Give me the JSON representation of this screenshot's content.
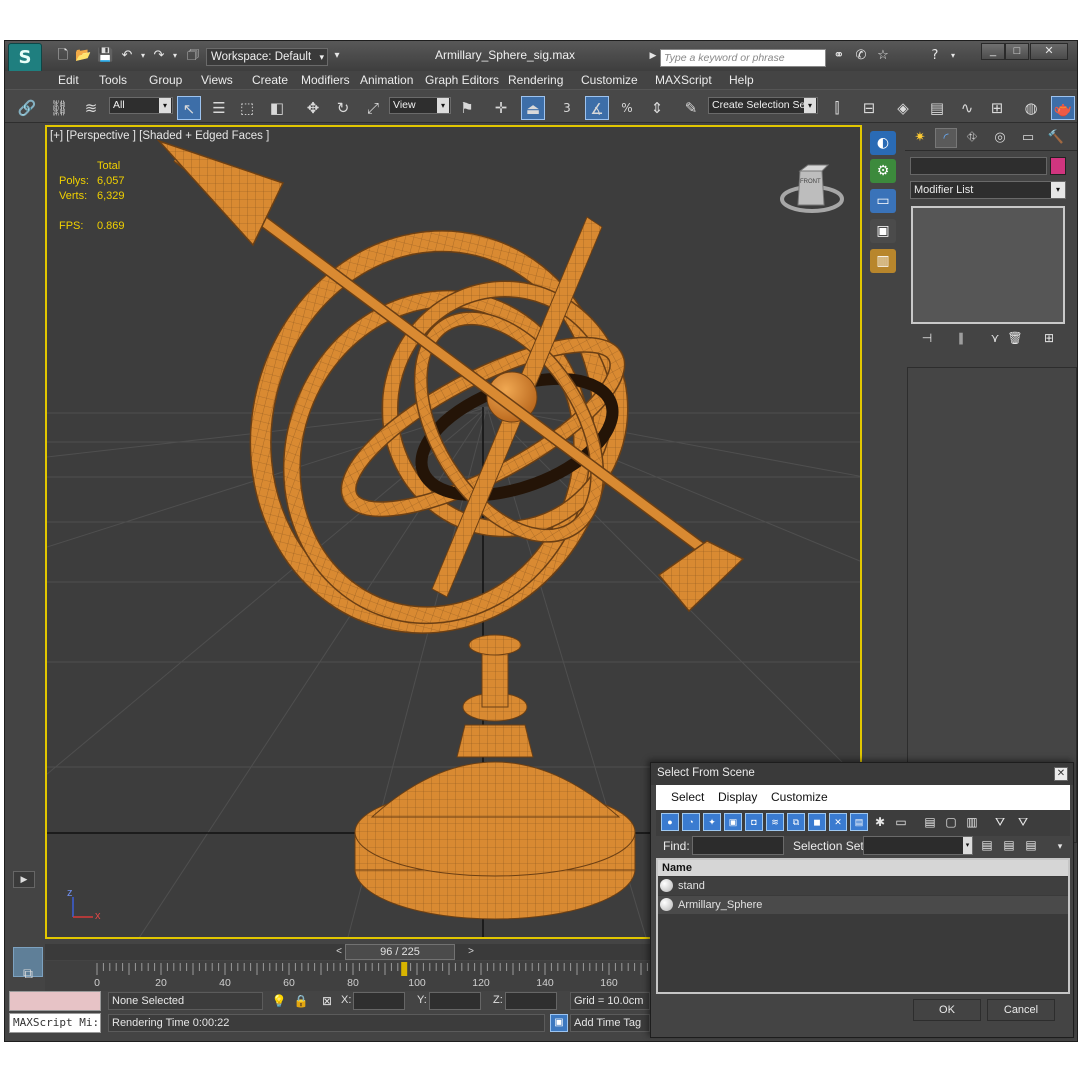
{
  "app": {
    "document_title": "Armillary_Sphere_sig.max",
    "workspace": "Workspace: Default",
    "search_placeholder": "Type a keyword or phrase",
    "window_buttons": [
      "_",
      "□",
      "✕"
    ]
  },
  "menu": [
    "Edit",
    "Tools",
    "Group",
    "Views",
    "Create",
    "Modifiers",
    "Animation",
    "Graph Editors",
    "Rendering",
    "Customize",
    "MAXScript",
    "Help"
  ],
  "toolbar": {
    "selection_filter": "All",
    "reference_coord": "View",
    "named_selection_placeholder": "Create Selection Se",
    "snap_label": "3",
    "angle_snap_label": "%"
  },
  "viewport": {
    "label": "[+] [Perspective ] [Shaded + Edged Faces ]",
    "stats_header": "Total",
    "polys_label": "Polys:",
    "polys_value": "6,057",
    "verts_label": "Verts:",
    "verts_value": "6,329",
    "fps_label": "FPS:",
    "fps_value": "0.869",
    "viewcube_face": "FRONT",
    "axis_labels": [
      "z",
      "x"
    ]
  },
  "command_panel": {
    "modifier_list": "Modifier List",
    "object_color": "#d1357f"
  },
  "timeline": {
    "frame_readout": "96 / 225",
    "current_frame": 96,
    "total_frames": 225,
    "ticks": [
      "0",
      "20",
      "40",
      "60",
      "80",
      "100",
      "120",
      "140",
      "160"
    ]
  },
  "status": {
    "maxscript_listener": "MAXScript Mi:",
    "selection": "None Selected",
    "prompt": "Rendering Time  0:00:22",
    "x_label": "X:",
    "y_label": "Y:",
    "z_label": "Z:",
    "grid": "Grid = 10.0cm",
    "add_time_tag": "Add Time Tag"
  },
  "dialog": {
    "title": "Select From Scene",
    "menu": [
      "Select",
      "Display",
      "Customize"
    ],
    "find_label": "Find:",
    "selection_set_label": "Selection Set:",
    "column_header": "Name",
    "items": [
      "stand",
      "Armillary_Sphere"
    ],
    "ok": "OK",
    "cancel": "Cancel"
  },
  "colors": {
    "model_orange": "#d98a32",
    "viewport_bg": "#3d3d3d",
    "active_border": "#e2c700",
    "stat_yellow": "#f1d100"
  }
}
